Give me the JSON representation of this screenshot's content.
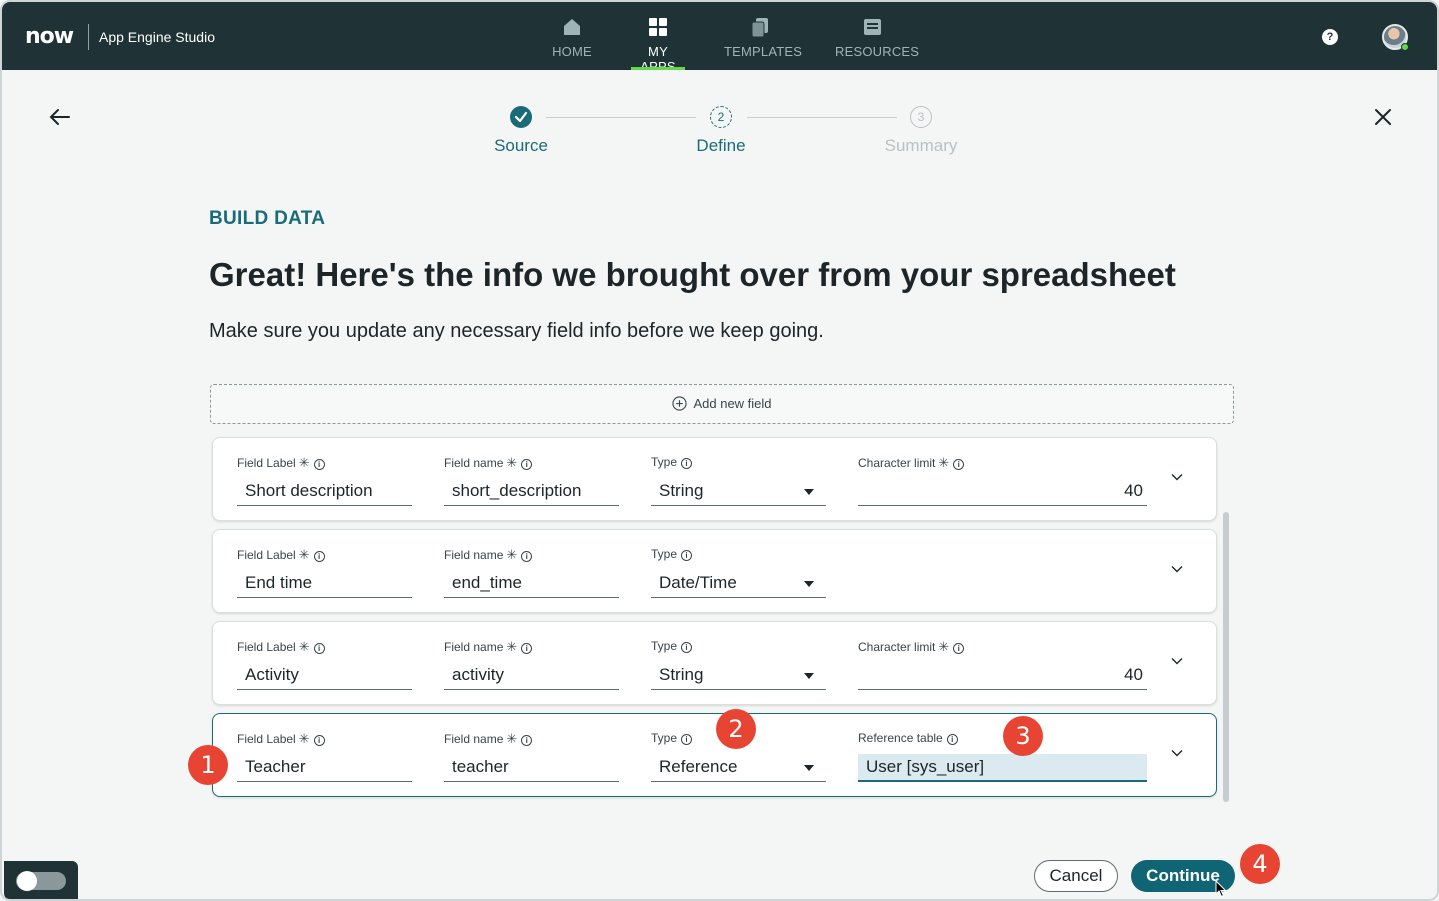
{
  "nav": {
    "logo": "now",
    "app_title": "App Engine Studio",
    "items": [
      {
        "label": "HOME",
        "icon": "home-icon",
        "active": false
      },
      {
        "label": "MY APPS",
        "icon": "apps-grid-icon",
        "active": true
      },
      {
        "label": "TEMPLATES",
        "icon": "templates-icon",
        "active": false
      },
      {
        "label": "RESOURCES",
        "icon": "resources-icon",
        "active": false
      }
    ],
    "help": "?"
  },
  "wizard": {
    "steps": [
      {
        "number": "1",
        "label": "Source",
        "state": "complete"
      },
      {
        "number": "2",
        "label": "Define",
        "state": "current"
      },
      {
        "number": "3",
        "label": "Summary",
        "state": "upcoming"
      }
    ]
  },
  "main": {
    "kicker": "BUILD DATA",
    "title": "Great! Here's the info we brought over from your spreadsheet",
    "subtitle": "Make sure you update any necessary field info before we keep going.",
    "add_field": "Add new field"
  },
  "labels": {
    "field_label": "Field Label",
    "field_name": "Field name",
    "type": "Type",
    "char_limit": "Character limit",
    "ref_table": "Reference table",
    "req_mark": "✳",
    "info_mark": "i"
  },
  "fields": [
    {
      "label": "Short description",
      "name": "short_description",
      "type": "String",
      "char_limit": "40"
    },
    {
      "label": "End time",
      "name": "end_time",
      "type": "Date/Time"
    },
    {
      "label": "Activity",
      "name": "activity",
      "type": "String",
      "char_limit": "40"
    },
    {
      "label": "Teacher",
      "name": "teacher",
      "type": "Reference",
      "ref_table": "User [sys_user]"
    }
  ],
  "badges": [
    "1",
    "2",
    "3",
    "4"
  ],
  "footer": {
    "cancel": "Cancel",
    "continue": "Continue"
  },
  "colors": {
    "nav_bg": "#1f3336",
    "accent": "#1a6b78",
    "primary_button": "#106575",
    "active_tab_underline": "#62d84e",
    "badge": "#e84434"
  }
}
